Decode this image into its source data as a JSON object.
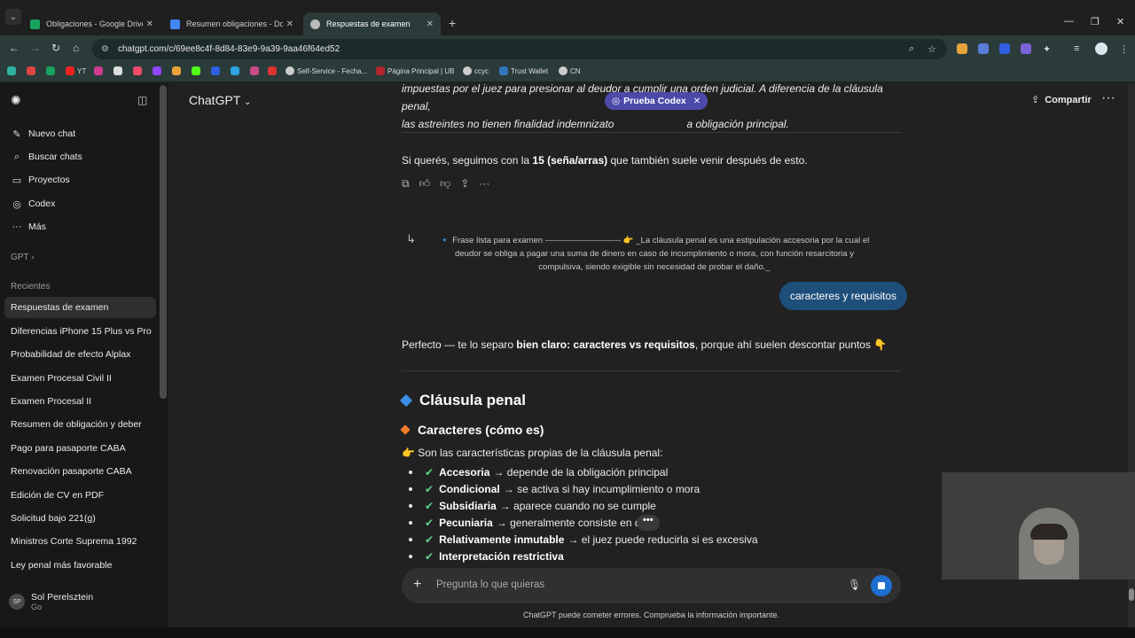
{
  "browser": {
    "tabs": [
      {
        "label": "Obligaciones - Google Drive",
        "color": "#1aa260"
      },
      {
        "label": "Resumen obligaciones - Docum",
        "color": "#4285f4"
      },
      {
        "label": "Respuestas de examen",
        "color": "#bbbbbb"
      }
    ],
    "url": "chatgpt.com/c/69ee8c4f-8d84-83e9-9a39-9aa46f64ed52",
    "bookmarks": [
      "YT",
      "Self-Service - Fecha...",
      "Página Principal | UB",
      "ccyc",
      "Trust Wallet",
      "CN"
    ]
  },
  "sidebar": {
    "top_items": [
      {
        "label": "Nuevo chat",
        "icon": "new-chat-icon"
      },
      {
        "label": "Buscar chats",
        "icon": "search-icon"
      },
      {
        "label": "Proyectos",
        "icon": "folder-icon"
      },
      {
        "label": "Codex",
        "icon": "codex-icon"
      },
      {
        "label": "Más",
        "icon": "more-icon"
      }
    ],
    "gpt_label": "GPT",
    "recents_label": "Recientes",
    "recents": [
      "Respuestas de examen",
      "Diferencias iPhone 15 Plus vs Pro",
      "Probabilidad de efecto Alplax",
      "Examen Procesal Civil II",
      "Examen Procesal II",
      "Resumen de obligación y deber",
      "Pago para pasaporte CABA",
      "Renovación pasaporte CABA",
      "Edición de CV en PDF",
      "Solicitud bajo 221(g)",
      "Ministros Corte Suprema 1992",
      "Ley penal más favorable"
    ],
    "user": {
      "initials": "SP",
      "name": "Sol Perelsztein",
      "plan": "Go"
    }
  },
  "header": {
    "model": "ChatGPT",
    "share": "Compartir",
    "codex_pill": "Prueba Codex"
  },
  "chat": {
    "top_italic_line1": "impuestas por el juez para presionar al deudor a cumplir una orden judicial. A diferencia de la cláusula penal,",
    "top_italic_line2_a": "las astreintes no tienen finalidad indemnizato",
    "top_italic_line2_b": "a obligación principal.",
    "followup_a": "Si querés, seguimos con la ",
    "followup_b": "15 (seña/arras)",
    "followup_c": " que también suele venir después de esto.",
    "quote_line1": "🔹 Frase lista para examen --------------------------- 👉 _La cláusula penal es una estipulación accesoria por la cual el",
    "quote_line2": "deudor se obliga a pagar una suma de dinero en caso de incumplimiento o mora, con función resarcitoria y",
    "quote_line3": "compulsiva, siendo exigible sin necesidad de probar el daño._",
    "user_message": "caracteres y requisitos",
    "answer_intro_a": "Perfecto — te lo separo ",
    "answer_intro_b": "bien claro: caracteres vs requisitos",
    "answer_intro_c": ", porque ahí suelen descontar puntos 👇",
    "section_title": "Cláusula penal",
    "subsection_title": "Caracteres (cómo es)",
    "lead": "👉 Son las características propias de la cláusula penal:",
    "features": [
      {
        "term": "Accesoria",
        "desc": "→ depende de la obligación principal"
      },
      {
        "term": "Condicional",
        "desc": "→ se activa si hay incumplimiento o mora"
      },
      {
        "term": "Subsidiaria",
        "desc": "→ aparece cuando no se cumple"
      },
      {
        "term": "Pecuniaria",
        "desc": "→ generalmente consiste en din"
      },
      {
        "term": "Relativamente inmutable",
        "desc": "→ el juez puede reducirla si es excesiva"
      },
      {
        "term": "Interpretación restrictiva",
        "desc": ""
      }
    ]
  },
  "composer": {
    "placeholder": "Pregunta lo que quieras",
    "disclaimer": "ChatGPT puede cometer errores. Comprueba la información importante."
  }
}
